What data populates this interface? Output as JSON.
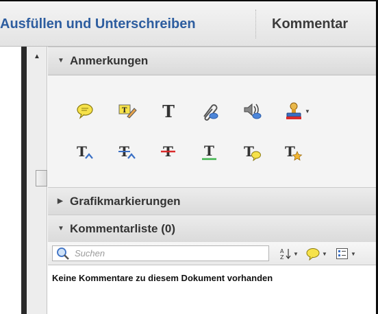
{
  "tabs": {
    "fill_sign": "Ausfüllen und Unterschreiben",
    "comment": "Kommentar"
  },
  "sections": {
    "annotations": "Anmerkungen",
    "drawing_markups": "Grafikmarkierungen",
    "comment_list": "Kommentarliste (0)"
  },
  "annotation_tools": [
    "sticky-note-icon",
    "highlight-text-icon",
    "add-text-icon",
    "attach-file-icon",
    "record-audio-icon",
    "stamp-icon",
    "insert-text-at-cursor-icon",
    "replace-text-icon",
    "strikethrough-icon",
    "underline-icon",
    "add-note-to-text-icon",
    "text-correction-markup-icon"
  ],
  "search": {
    "placeholder": "Suchen"
  },
  "empty_message": "Keine Kommentare zu diesem Dokument vorhanden",
  "colors": {
    "active_tab": "#2d5d9f",
    "note_yellow": "#f6e24a",
    "strike_red": "#d92b2b",
    "underline_green": "#3db34a",
    "markup_blue": "#3a6fc4"
  }
}
